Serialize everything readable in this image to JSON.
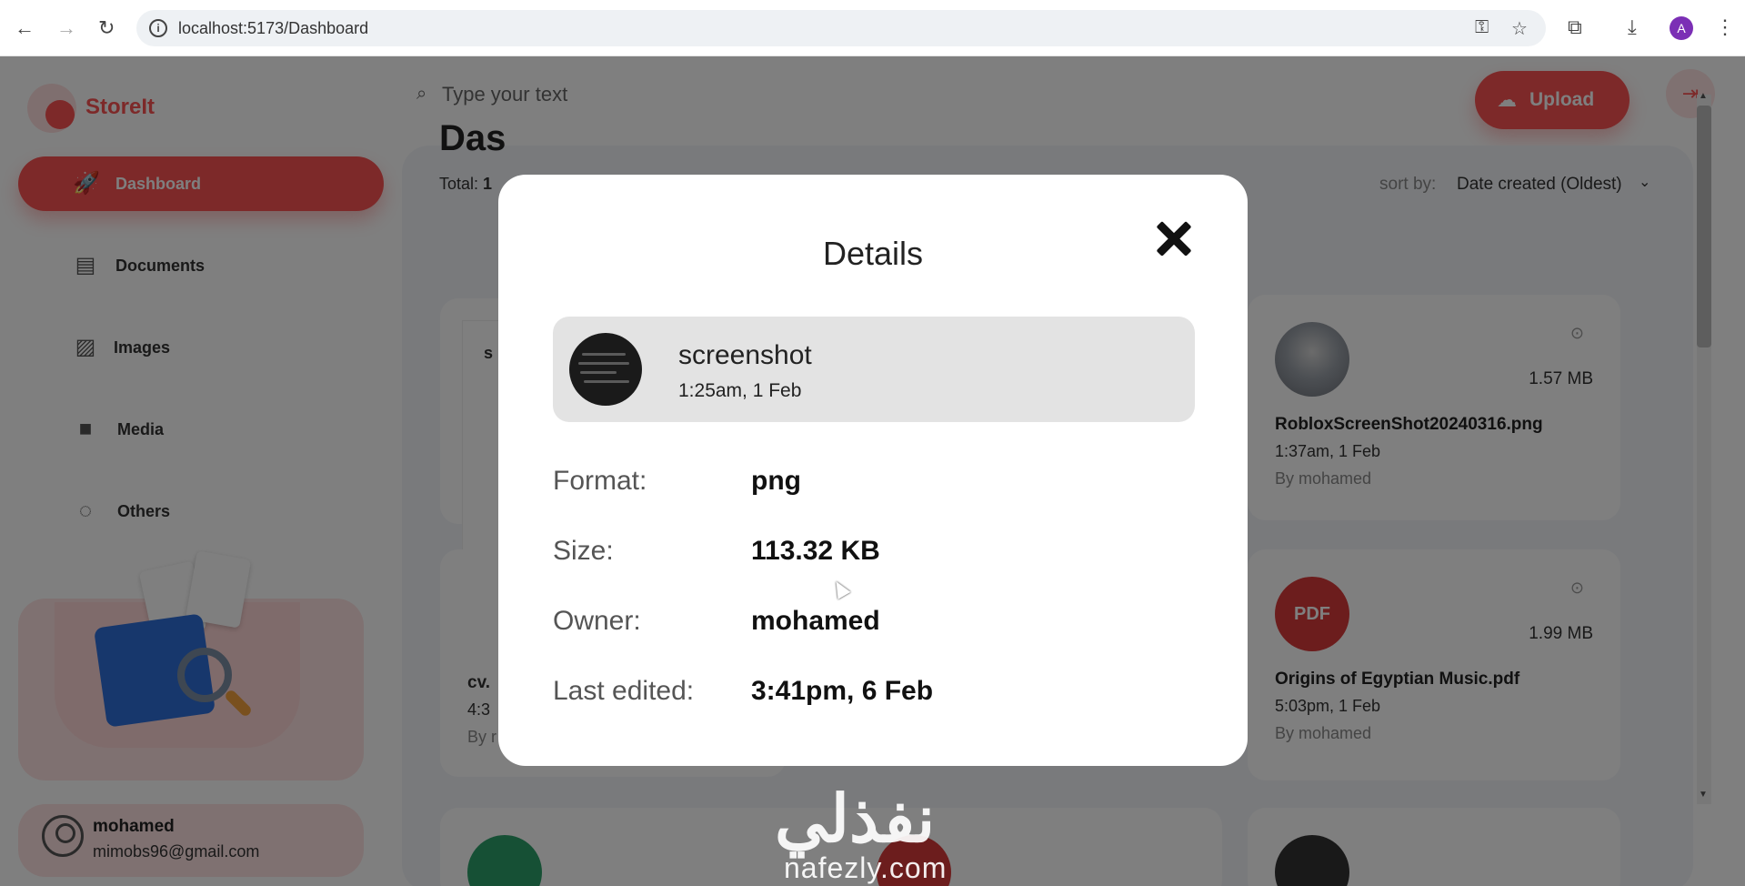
{
  "browser": {
    "url": "localhost:5173/Dashboard",
    "profile_initial": "A"
  },
  "app": {
    "name": "StoreIt",
    "search_placeholder": "Type your text",
    "upload_label": "Upload",
    "sidebar": [
      {
        "label": "Dashboard",
        "icon": "rocket-icon",
        "active": true
      },
      {
        "label": "Documents",
        "icon": "document-icon",
        "active": false
      },
      {
        "label": "Images",
        "icon": "image-icon",
        "active": false
      },
      {
        "label": "Media",
        "icon": "video-icon",
        "active": false
      },
      {
        "label": "Others",
        "icon": "more-icon",
        "active": false
      }
    ],
    "user": {
      "name": "mohamed",
      "email": "mimobs96@gmail.com"
    },
    "page_title": "Das",
    "total_label": "Total:",
    "total_value": "1",
    "sort_label": "sort by:",
    "sort_value": "Date created (Oldest)",
    "cards": [
      {
        "name": "RobloxScreenShot20240316.png",
        "size": "1.57 MB",
        "date": "1:37am, 1 Feb",
        "owner": "By mohamed"
      },
      {
        "name": "Origins of Egyptian Music.pdf",
        "size": "1.99 MB",
        "date": "5:03pm, 1 Feb",
        "owner": "By mohamed",
        "thumb_label": "PDF"
      }
    ],
    "partial_card": {
      "title": "s",
      "name": "cv.",
      "date": "4:3",
      "owner": "By r"
    }
  },
  "modal": {
    "title": "Details",
    "file_name": "screenshot",
    "file_date": "1:25am, 1 Feb",
    "rows": [
      {
        "label": "Format:",
        "value": "png"
      },
      {
        "label": "Size:",
        "value": "113.32 KB"
      },
      {
        "label": "Owner:",
        "value": "mohamed"
      },
      {
        "label": "Last edited:",
        "value": "3:41pm, 6 Feb"
      }
    ]
  },
  "watermark": {
    "arabic": "نفذلي",
    "latin": "nafezly.com"
  },
  "colors": {
    "brand": "#fa5252",
    "brand_light": "#ffe3e3",
    "overlay": "rgba(0,0,0,0.5)"
  }
}
